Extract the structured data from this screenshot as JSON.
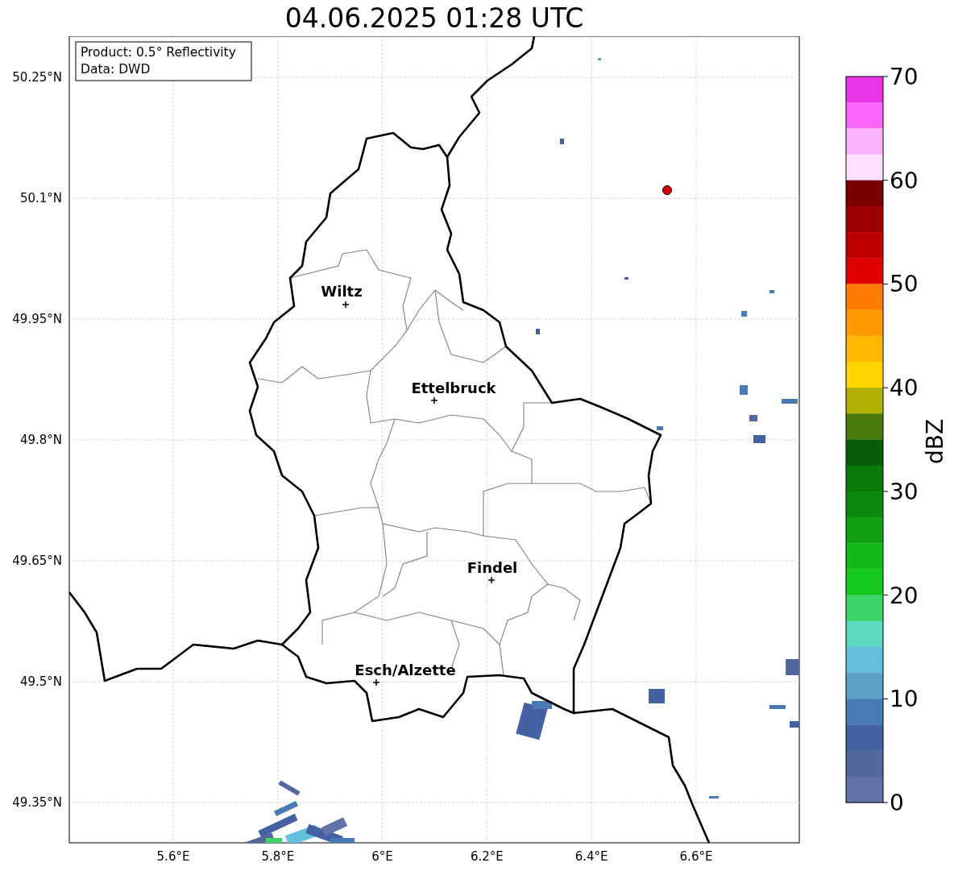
{
  "title": "04.06.2025 01:28 UTC",
  "info_box": {
    "lines": [
      "Product: 0.5° Reflectivity",
      "Data: DWD"
    ]
  },
  "map": {
    "lat_ticks": [
      "50.25°N",
      "50.1°N",
      "49.95°N",
      "49.8°N",
      "49.65°N",
      "49.5°N",
      "49.35°N"
    ],
    "lon_ticks": [
      "5.6°E",
      "5.8°E",
      "6°E",
      "6.2°E",
      "6.4°E",
      "6.6°E"
    ],
    "cities": [
      {
        "label": "Wiltz"
      },
      {
        "label": "Ettelbruck"
      },
      {
        "label": "Findel"
      },
      {
        "label": "Esch/Alzette"
      }
    ]
  },
  "colorbar": {
    "label": "dBZ",
    "ticks": [
      "70",
      "60",
      "50",
      "40",
      "30",
      "20",
      "10",
      "0"
    ],
    "bins": [
      {
        "color": "#ea34ea"
      },
      {
        "color": "#fd66fd"
      },
      {
        "color": "#fdb2fd"
      },
      {
        "color": "#fde0fd"
      },
      {
        "color": "#7a0000"
      },
      {
        "color": "#9c0000"
      },
      {
        "color": "#bd0000"
      },
      {
        "color": "#e00000"
      },
      {
        "color": "#ff7b00"
      },
      {
        "color": "#ff9b00"
      },
      {
        "color": "#ffb700"
      },
      {
        "color": "#ffd600"
      },
      {
        "color": "#b0b000"
      },
      {
        "color": "#4a7a0a"
      },
      {
        "color": "#075c0a"
      },
      {
        "color": "#0a7a0a"
      },
      {
        "color": "#0c8a10"
      },
      {
        "color": "#0ea010"
      },
      {
        "color": "#10b818"
      },
      {
        "color": "#12c91c"
      },
      {
        "color": "#3dd46a"
      },
      {
        "color": "#5fd8c0"
      },
      {
        "color": "#65c0dd"
      },
      {
        "color": "#5ca0c8"
      },
      {
        "color": "#4a7ab4"
      },
      {
        "color": "#4461a2"
      },
      {
        "color": "#53679e"
      },
      {
        "color": "#6372a8"
      }
    ]
  }
}
